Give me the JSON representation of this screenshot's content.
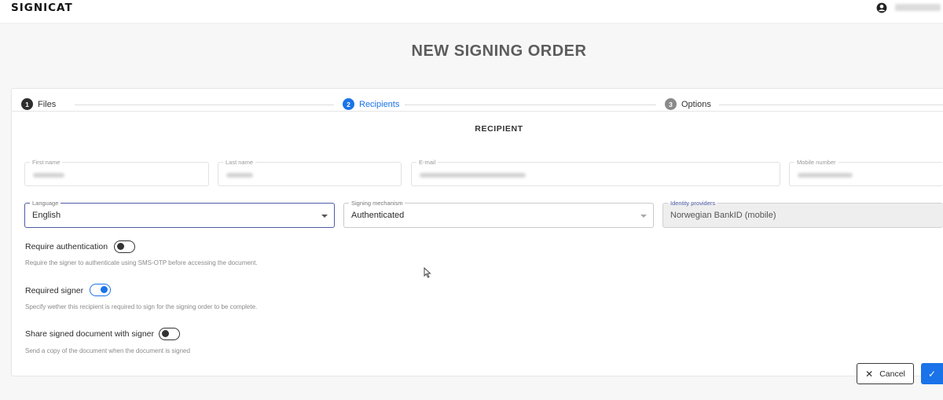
{
  "header": {
    "logo": "SIGNICAT",
    "user_icon": "account-circle-icon"
  },
  "page": {
    "title": "NEW SIGNING ORDER"
  },
  "stepper": {
    "steps": [
      {
        "number": "1",
        "label": "Files",
        "state": "complete"
      },
      {
        "number": "2",
        "label": "Recipients",
        "state": "active"
      },
      {
        "number": "3",
        "label": "Options",
        "state": "upcoming"
      }
    ]
  },
  "recipient": {
    "title": "RECIPIENT",
    "fields": {
      "first_name": {
        "label": "First name"
      },
      "last_name": {
        "label": "Last name"
      },
      "email": {
        "label": "E-mail"
      },
      "mobile": {
        "label": "Mobile number"
      }
    },
    "language": {
      "label": "Language",
      "value": "English"
    },
    "signing_mechanism": {
      "label": "Signing mechanism",
      "value": "Authenticated"
    },
    "identity_providers": {
      "label": "Identity providers",
      "value": "Norwegian BankID (mobile)"
    },
    "options": [
      {
        "title": "Require authentication",
        "description": "Require the signer to authenticate using SMS-OTP before accessing the document.",
        "enabled": false
      },
      {
        "title": "Required signer",
        "description": "Specify wether this recipient is required to sign for the signing order to be complete.",
        "enabled": true
      },
      {
        "title": "Share signed document with signer",
        "description": "Send a copy of the document when the document is signed",
        "enabled": false
      }
    ]
  },
  "actions": {
    "cancel_label": "Cancel",
    "cancel_icon": "close-icon",
    "confirm_icon": "check-icon"
  },
  "colors": {
    "accent": "#1a73e8",
    "focus_border": "#4e5ba6",
    "title_gray": "#5c5c5c"
  }
}
